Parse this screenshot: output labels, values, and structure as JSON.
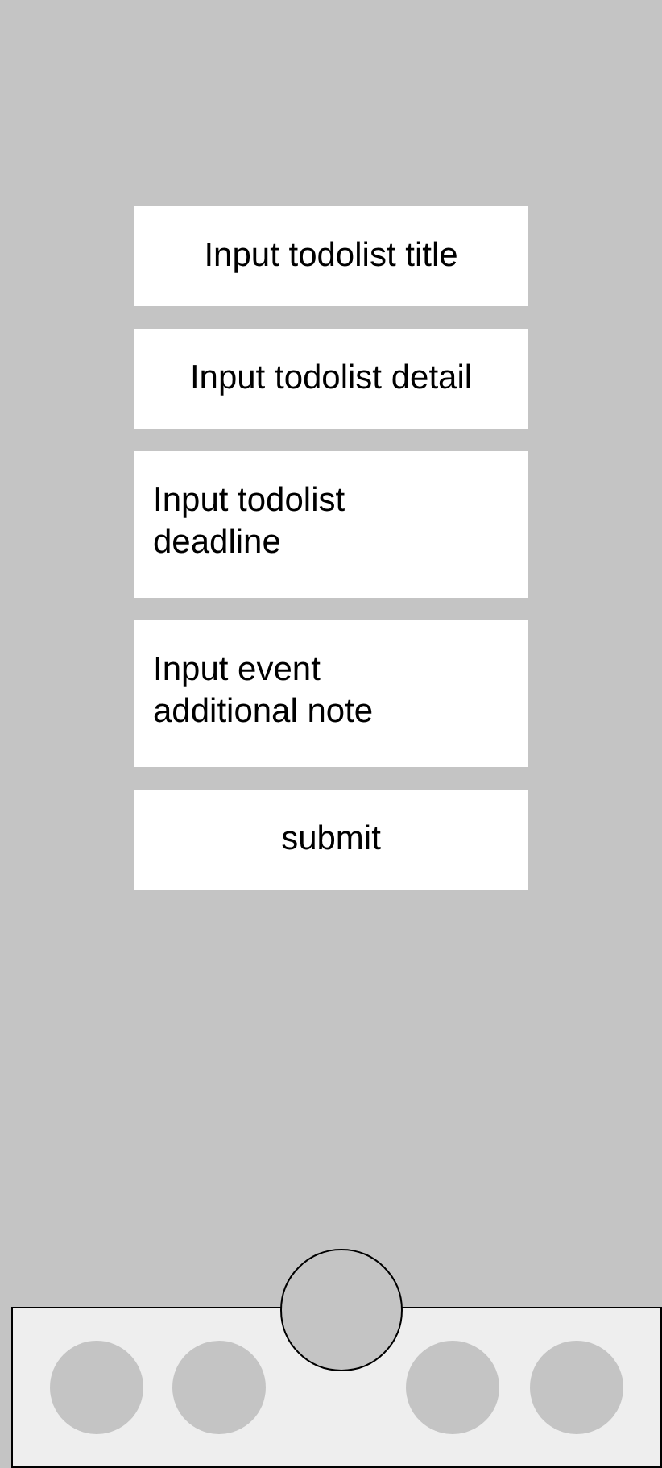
{
  "form": {
    "fields": [
      {
        "placeholder": "Input todolist title",
        "kind": "single"
      },
      {
        "placeholder": "Input todolist detail",
        "kind": "single"
      },
      {
        "placeholder": "Input todolist deadline",
        "kind": "multi"
      },
      {
        "placeholder": "Input event additional note",
        "kind": "multi"
      }
    ],
    "submit": "submit"
  },
  "bottom_nav": {
    "items": [
      {
        "kind": "tab"
      },
      {
        "kind": "tab"
      },
      {
        "kind": "center"
      },
      {
        "kind": "tab"
      },
      {
        "kind": "tab"
      }
    ]
  }
}
